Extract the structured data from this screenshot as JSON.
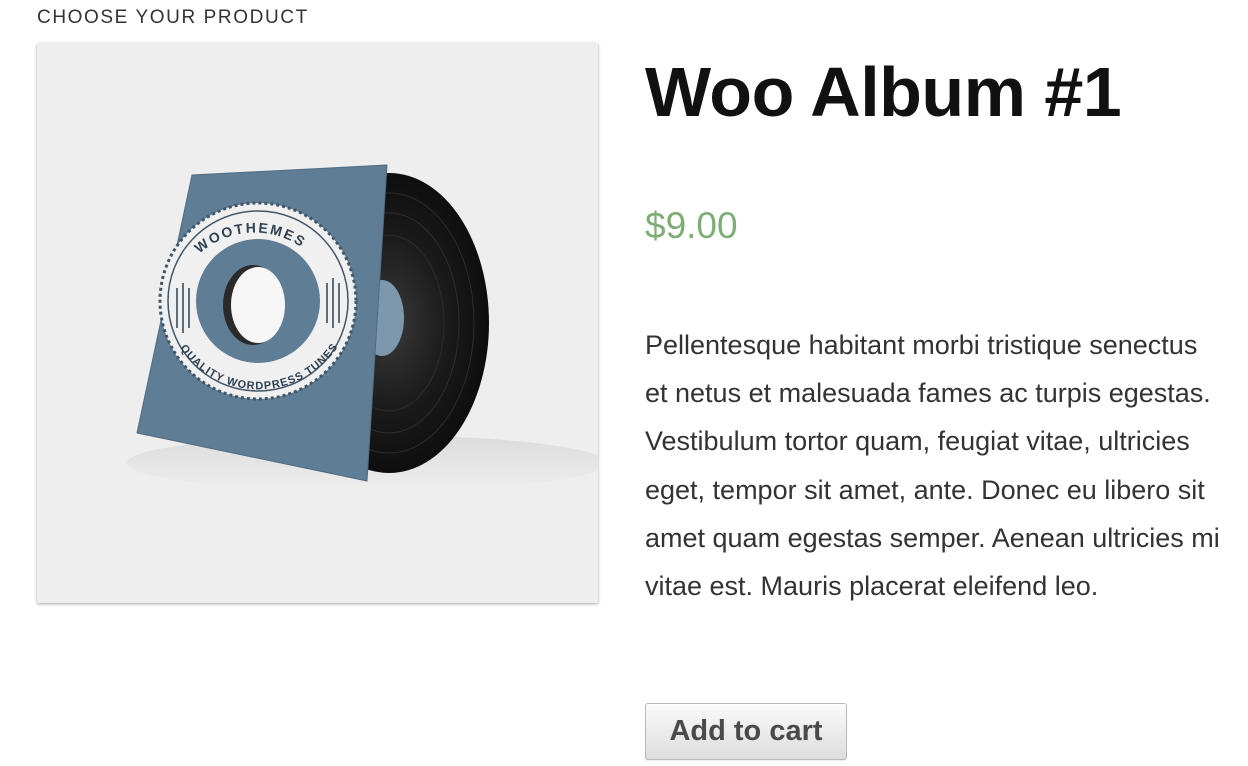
{
  "section": {
    "label": "CHOOSE YOUR PRODUCT"
  },
  "product": {
    "image_alt": "Woo Album #1 cover",
    "cover_text_top": "WOOTHEMES",
    "cover_text_bottom": "QUALITY WORDPRESS TUNES",
    "title": "Woo Album #1",
    "price": "$9.00",
    "description": "Pellentesque habitant morbi tristique senectus et netus et malesuada fames ac turpis egestas. Vestibulum tortor quam, feugiat vitae, ultricies eget, tempor sit amet, ante. Donec eu libero sit amet quam egestas semper. Aenean ultricies mi vitae est. Mauris placerat eleifend leo.",
    "add_to_cart_label": "Add to cart"
  },
  "colors": {
    "price": "#7fad75",
    "sleeve": "#5f7d94",
    "vinyl": "#1c1c1c",
    "image_background": "#eeeeee"
  }
}
